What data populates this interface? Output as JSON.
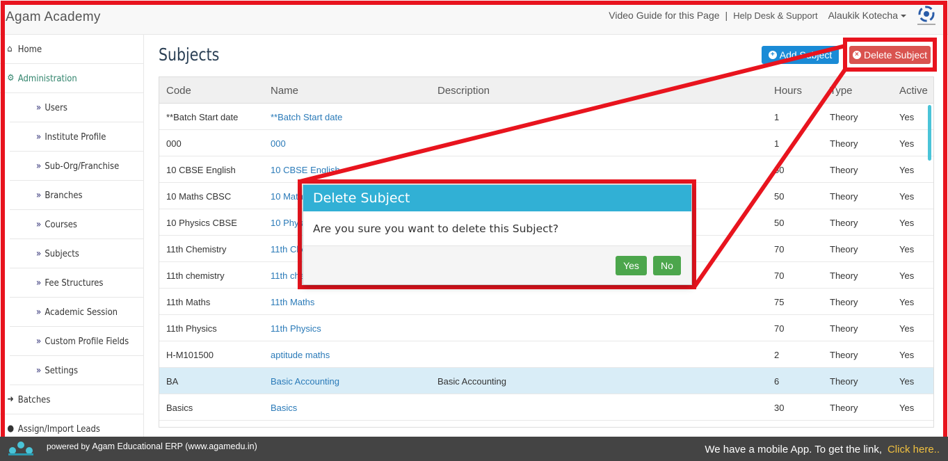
{
  "app": {
    "title": "Agam Academy"
  },
  "topnav": {
    "video_guide": "Video Guide for this Page",
    "separator": "|",
    "help": "Help Desk & Support",
    "user": "Alaukik Kotecha"
  },
  "sidebar": {
    "items": [
      {
        "label": "Home",
        "icon": "home-icon",
        "level": "top"
      },
      {
        "label": "Administration",
        "icon": "gear-icon",
        "level": "top",
        "active": true
      },
      {
        "label": "Users",
        "level": "sub"
      },
      {
        "label": "Institute Profile",
        "level": "sub"
      },
      {
        "label": "Sub-Org/Franchise",
        "level": "sub"
      },
      {
        "label": "Branches",
        "level": "sub"
      },
      {
        "label": "Courses",
        "level": "sub"
      },
      {
        "label": "Subjects",
        "level": "sub"
      },
      {
        "label": "Fee Structures",
        "level": "sub"
      },
      {
        "label": "Academic Session",
        "level": "sub"
      },
      {
        "label": "Custom Profile Fields",
        "level": "sub"
      },
      {
        "label": "Settings",
        "level": "sub"
      },
      {
        "label": "Batches",
        "icon": "sign-in-icon",
        "level": "top"
      },
      {
        "label": "Assign/Import Leads",
        "icon": "user-icon",
        "level": "top"
      }
    ]
  },
  "page": {
    "title": "Subjects",
    "add_button": "Add Subject",
    "delete_button": "Delete Subject"
  },
  "table": {
    "headers": [
      "Code",
      "Name",
      "Description",
      "Hours",
      "Type",
      "Active"
    ],
    "rows": [
      {
        "code": "**Batch Start date",
        "name": "**Batch Start date",
        "description": "",
        "hours": "1",
        "type": "Theory",
        "active": "Yes"
      },
      {
        "code": "000",
        "name": "000",
        "description": "",
        "hours": "1",
        "type": "Theory",
        "active": "Yes"
      },
      {
        "code": "10 CBSE English",
        "name": "10 CBSE English",
        "description": "",
        "hours": "50",
        "type": "Theory",
        "active": "Yes"
      },
      {
        "code": "10 Maths CBSC",
        "name": "10 Maths CBSC",
        "description": "",
        "hours": "50",
        "type": "Theory",
        "active": "Yes"
      },
      {
        "code": "10 Physics CBSE",
        "name": "10 Physics CBSE",
        "description": "",
        "hours": "50",
        "type": "Theory",
        "active": "Yes"
      },
      {
        "code": "11th Chemistry",
        "name": "11th Chemistry",
        "description": "",
        "hours": "70",
        "type": "Theory",
        "active": "Yes"
      },
      {
        "code": "11th chemistry",
        "name": "11th chemistry",
        "description": "",
        "hours": "70",
        "type": "Theory",
        "active": "Yes"
      },
      {
        "code": "11th Maths",
        "name": "11th Maths",
        "description": "",
        "hours": "75",
        "type": "Theory",
        "active": "Yes"
      },
      {
        "code": "11th Physics",
        "name": "11th Physics",
        "description": "",
        "hours": "70",
        "type": "Theory",
        "active": "Yes"
      },
      {
        "code": "H-M101500",
        "name": "aptitude maths",
        "description": "",
        "hours": "2",
        "type": "Theory",
        "active": "Yes"
      },
      {
        "code": "BA",
        "name": "Basic Accounting",
        "description": "Basic Accounting",
        "hours": "6",
        "type": "Theory",
        "active": "Yes",
        "selected": true
      },
      {
        "code": "Basics",
        "name": "Basics",
        "description": "",
        "hours": "30",
        "type": "Theory",
        "active": "Yes"
      }
    ]
  },
  "modal": {
    "title": "Delete Subject",
    "message": "Are you sure you want to delete this Subject?",
    "yes": "Yes",
    "no": "No"
  },
  "footer": {
    "powered_prefix": "powered by",
    "powered_by": "Agam Educational ERP (www.agamedu.in)",
    "mobile_text": "We have a mobile App. To get the link,",
    "click_here": "Click here.."
  },
  "colors": {
    "annotation_red": "#e8141e",
    "modal_header": "#31b0d5",
    "delete_button": "#d9534f",
    "add_button": "#1a8bd6",
    "confirm_buttons": "#4ca64c"
  }
}
